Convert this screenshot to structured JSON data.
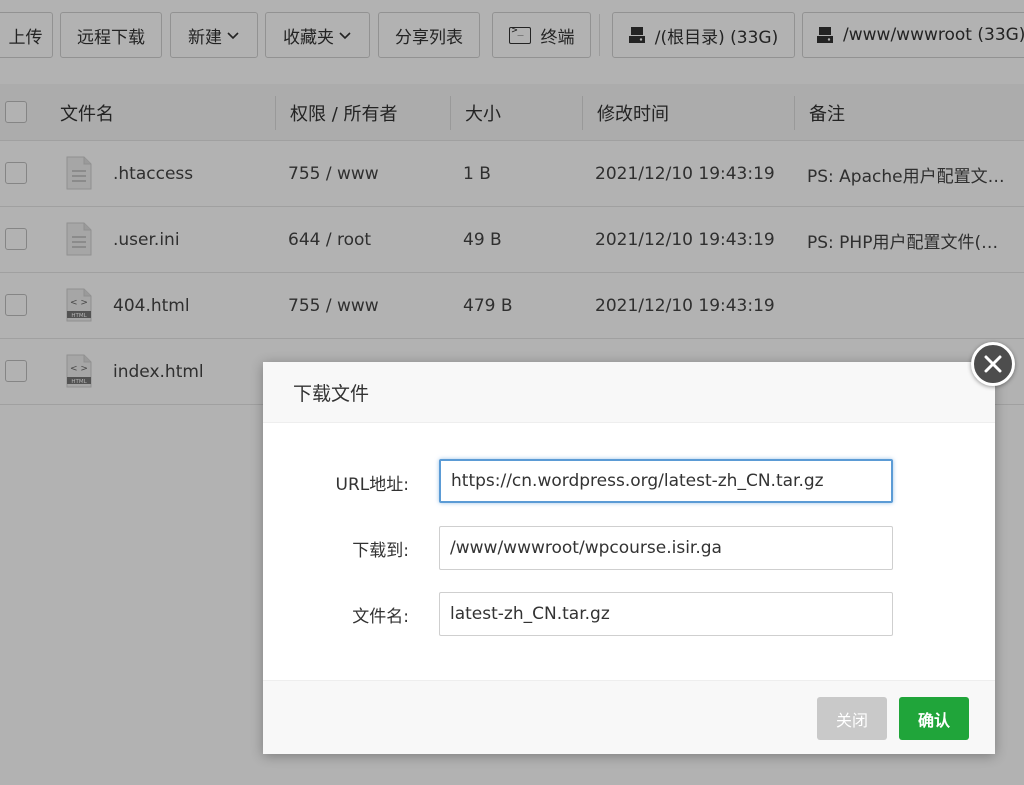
{
  "toolbar": {
    "upload": "上传",
    "remote_download": "远程下载",
    "new": "新建",
    "favorites": "收藏夹",
    "share_list": "分享列表",
    "terminal": "终端",
    "disk_root": "/(根目录) (33G)",
    "disk_www": "/www/wwwroot (33G)"
  },
  "table": {
    "headers": {
      "name": "文件名",
      "perm": "权限 / 所有者",
      "size": "大小",
      "mtime": "修改时间",
      "note": "备注"
    },
    "rows": [
      {
        "name": ".htaccess",
        "perm": "755 / www",
        "size": "1 B",
        "mtime": "2021/12/10 19:43:19",
        "note": "PS: Apache用户配置文…",
        "icon": "file-icon"
      },
      {
        "name": ".user.ini",
        "perm": "644 / root",
        "size": "49 B",
        "mtime": "2021/12/10 19:43:19",
        "note": "PS: PHP用户配置文件(…",
        "icon": "file-icon"
      },
      {
        "name": "404.html",
        "perm": "755 / www",
        "size": "479 B",
        "mtime": "2021/12/10 19:43:19",
        "note": "",
        "icon": "html-file-icon"
      },
      {
        "name": "index.html",
        "perm": "",
        "size": "",
        "mtime": "",
        "note": "",
        "icon": "html-file-icon"
      }
    ]
  },
  "modal": {
    "title": "下载文件",
    "url_label": "URL地址:",
    "url_value": "https://cn.wordpress.org/latest-zh_CN.tar.gz",
    "dest_label": "下载到:",
    "dest_value": "/www/wwwroot/wpcourse.isir.ga",
    "filename_label": "文件名:",
    "filename_value": "latest-zh_CN.tar.gz",
    "close_button": "关闭",
    "confirm_button": "确认"
  },
  "colors": {
    "accent": "#20a53a",
    "focus_border": "#5b9bd5",
    "close_btn": "#c9c9c9"
  }
}
